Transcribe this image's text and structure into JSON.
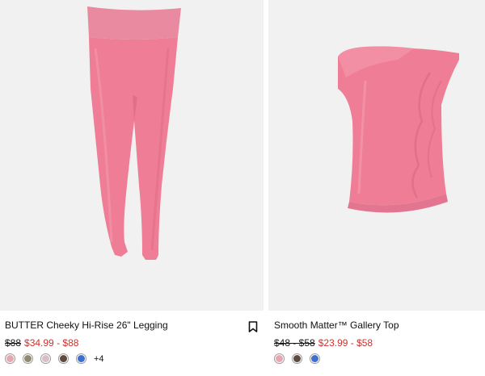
{
  "products": [
    {
      "title": "BUTTER Cheeky Hi-Rise 26\" Legging",
      "price_old": "$88",
      "price_sale": "$34.99 - $88",
      "swatches": [
        "#e8a6b3",
        "#8f8a70",
        "#d8bfc6",
        "#5e4a3e",
        "#3d6fd0"
      ],
      "more_colors": "+4",
      "bookmark_icon": "bookmark-icon"
    },
    {
      "title": "Smooth Matter™ Gallery Top",
      "price_old": "$48 - $58",
      "price_sale": "$23.99 - $58",
      "swatches": [
        "#e8a6b3",
        "#5e4a3e",
        "#3d6fd0"
      ]
    }
  ],
  "colors": {
    "product_pink": "#ef7d95",
    "sale_red": "#d0312d",
    "image_bg": "#f1f1f1"
  }
}
